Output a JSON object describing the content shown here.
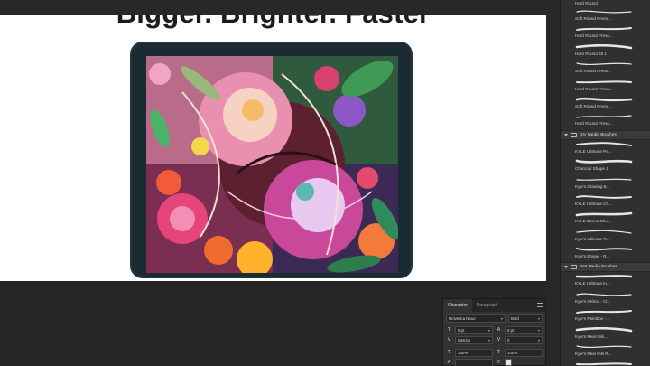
{
  "canvas": {
    "headline": "Bigger. Brighter. Faster"
  },
  "brushes_panel": {
    "top_label": "Hard Round",
    "sections": [
      {
        "items": [
          "Soft Round Press...",
          "Hard Round Press...",
          "Hard Round 35 1",
          "Soft Round Press...",
          "Hard Round Press...",
          "Soft Round Press...",
          "Hard Round Press..."
        ]
      },
      {
        "group": "Dry Media Brushes",
        "items": [
          "KYLE Ultimate Pe...",
          "Charcoal Shape 1",
          "Kyle's Drawing B...",
          "KYLE Ultimate Ch...",
          "KYLE Bonus Chu...",
          "Kyle's Ultimate R...",
          "Kyle's Eraser - R..."
        ]
      },
      {
        "group": "Wet Media Brushes",
        "items": [
          "KYLE Ultimate In...",
          "Kyle's Inkbox - Cl...",
          "Kyle's Paintbox -...",
          "Kyle's Real Oils...",
          "Kyle's Real Oils R...",
          "Kyle's Real Water..."
        ]
      }
    ]
  },
  "character_panel": {
    "tabs": [
      "Character",
      "Paragraph"
    ],
    "active_tab": "Character",
    "font_family": "Helvetica Neue",
    "font_style": "Bold",
    "font_size": "9 pt",
    "leading": "9 pt",
    "kerning": "Metrics",
    "tracking": "0",
    "vertical_scale": "100%",
    "horizontal_scale": "100%"
  },
  "colors": {
    "workspace": "#282828",
    "panel": "#303030",
    "tablet_frame": "#1c2a33"
  }
}
